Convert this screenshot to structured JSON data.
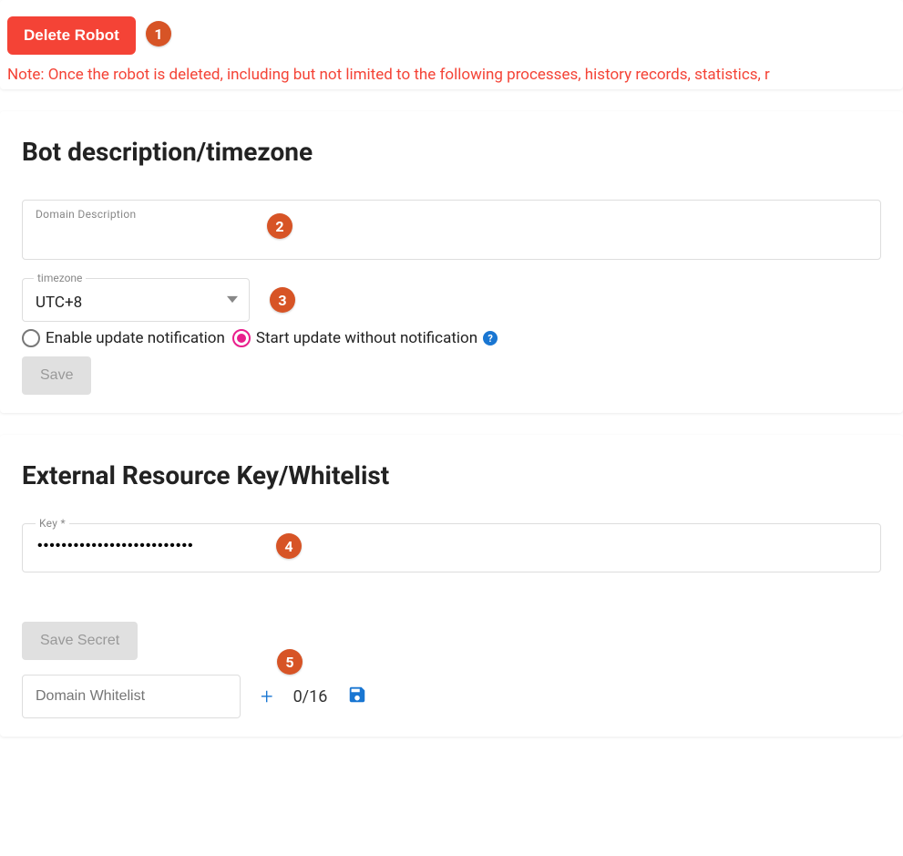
{
  "top": {
    "delete_label": "Delete Robot",
    "note_text": "Note: Once the robot is deleted, including but not limited to the following processes, history records, statistics, r"
  },
  "steps": {
    "s1": "1",
    "s2": "2",
    "s3": "3",
    "s4": "4",
    "s5": "5"
  },
  "desc": {
    "heading": "Bot description/timezone",
    "domain_desc_label": "Domain Description",
    "domain_desc_value": "",
    "timezone_label": "timezone",
    "timezone_value": "UTC+8",
    "radio_enable_label": "Enable update notification",
    "radio_start_label": "Start update without notification",
    "help_icon_text": "?",
    "save_label": "Save"
  },
  "ext": {
    "heading": "External Resource Key/Whitelist",
    "key_label": "Key *",
    "key_value": "••••••••••••••••••••••••••",
    "save_secret_label": "Save Secret",
    "whitelist_placeholder": "Domain Whitelist",
    "whitelist_count": "0/16",
    "plus_symbol": "+"
  }
}
